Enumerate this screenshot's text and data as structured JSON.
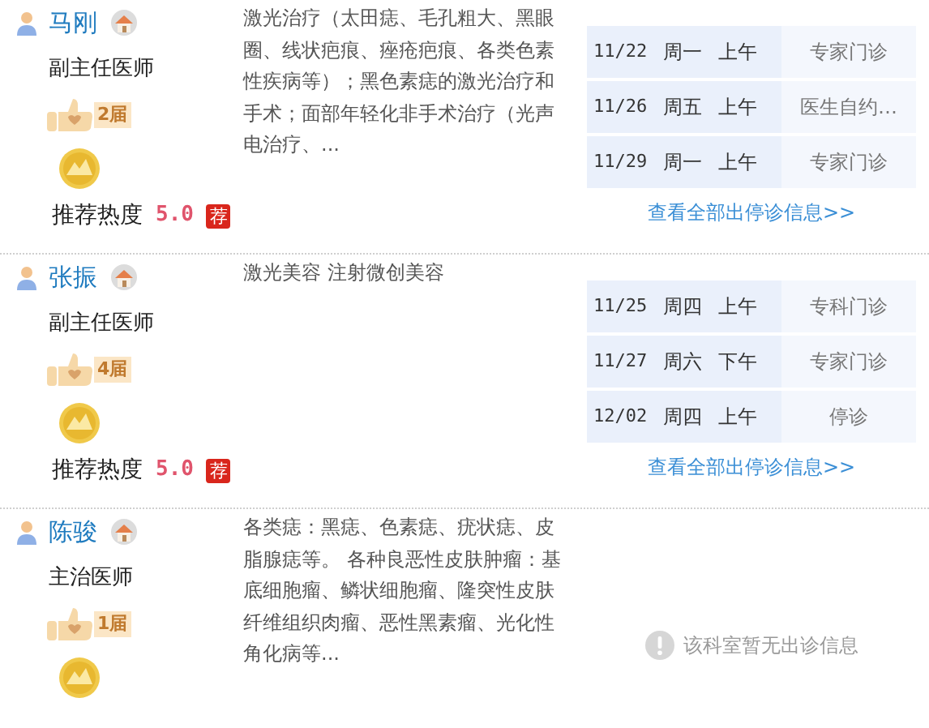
{
  "doctors": [
    {
      "name": "马刚",
      "title": "副主任医师",
      "award": "2届",
      "description": "激光治疗（太田痣、毛孔粗大、黑眼圈、线状疤痕、痤疮疤痕、各类色素性疾病等）；黑色素痣的激光治疗和手术；面部年轻化非手术治疗（光声电治疗、...",
      "rating": {
        "label": "推荐热度",
        "score": "5.0",
        "badge": "荐"
      },
      "schedule": [
        {
          "date": "11/22",
          "weekday": "周一",
          "period": "上午",
          "type": "专家门诊"
        },
        {
          "date": "11/26",
          "weekday": "周五",
          "period": "上午",
          "type": "医生自约…"
        },
        {
          "date": "11/29",
          "weekday": "周一",
          "period": "上午",
          "type": "专家门诊"
        }
      ],
      "schedule_link": "查看全部出停诊信息>>"
    },
    {
      "name": "张振",
      "title": "副主任医师",
      "award": "4届",
      "description": "激光美容 注射微创美容",
      "rating": {
        "label": "推荐热度",
        "score": "5.0",
        "badge": "荐"
      },
      "schedule": [
        {
          "date": "11/25",
          "weekday": "周四",
          "period": "上午",
          "type": "专科门诊"
        },
        {
          "date": "11/27",
          "weekday": "周六",
          "period": "下午",
          "type": "专家门诊"
        },
        {
          "date": "12/02",
          "weekday": "周四",
          "period": "上午",
          "type": "停诊"
        }
      ],
      "schedule_link": "查看全部出停诊信息>>"
    },
    {
      "name": "陈骏",
      "title": "主治医师",
      "award": "1届",
      "description": "各类痣：黑痣、色素痣、疣状痣、皮脂腺痣等。 各种良恶性皮肤肿瘤：基底细胞瘤、鳞状细胞瘤、隆突性皮肤纤维组织肉瘤、恶性黑素瘤、光化性角化病等...",
      "empty_note": "该科室暂无出诊信息"
    }
  ]
}
